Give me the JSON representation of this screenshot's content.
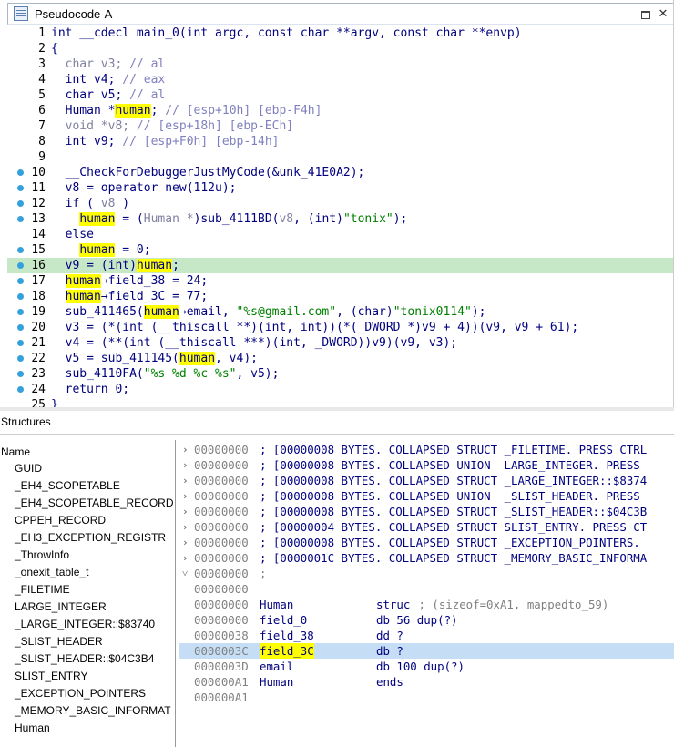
{
  "pseudocode": {
    "tab_title": "Pseudocode-A",
    "max_icon": "maximize-icon",
    "close_icon": "close-icon",
    "lines": [
      {
        "n": "1",
        "bp": false,
        "tokens": [
          {
            "t": "int __cdecl main_0(int argc, const char **argv, const char **envp)",
            "c": "kw"
          }
        ]
      },
      {
        "n": "2",
        "bp": false,
        "tokens": [
          {
            "t": "{",
            "c": "kw"
          }
        ]
      },
      {
        "n": "3",
        "bp": false,
        "tokens": [
          {
            "t": "  char v3; ",
            "c": "dim"
          },
          {
            "t": "// al",
            "c": "cm"
          }
        ]
      },
      {
        "n": "4",
        "bp": false,
        "tokens": [
          {
            "t": "  int v4; ",
            "c": "kw"
          },
          {
            "t": "// eax",
            "c": "cm"
          }
        ]
      },
      {
        "n": "5",
        "bp": false,
        "tokens": [
          {
            "t": "  char v5; ",
            "c": "kw"
          },
          {
            "t": "// al",
            "c": "cm"
          }
        ]
      },
      {
        "n": "6",
        "bp": false,
        "tokens": [
          {
            "t": "  Human *",
            "c": "kw"
          },
          {
            "t": "human",
            "c": "hlw"
          },
          {
            "t": "; ",
            "c": "kw"
          },
          {
            "t": "// [esp+10h] [ebp-F4h]",
            "c": "cm"
          }
        ]
      },
      {
        "n": "7",
        "bp": false,
        "tokens": [
          {
            "t": "  void *v8; ",
            "c": "dim"
          },
          {
            "t": "// [esp+18h] [ebp-ECh]",
            "c": "cm"
          }
        ]
      },
      {
        "n": "8",
        "bp": false,
        "tokens": [
          {
            "t": "  int v9; ",
            "c": "kw"
          },
          {
            "t": "// [esp+F0h] [ebp-14h]",
            "c": "cm"
          }
        ]
      },
      {
        "n": "9",
        "bp": false,
        "tokens": [
          {
            "t": "",
            "c": "kw"
          }
        ]
      },
      {
        "n": "10",
        "bp": true,
        "tokens": [
          {
            "t": "  __CheckForDebuggerJustMyCode(&unk_41E0A2);",
            "c": "kw"
          }
        ]
      },
      {
        "n": "11",
        "bp": true,
        "tokens": [
          {
            "t": "  v8 = operator new(112u);",
            "c": "kw"
          }
        ]
      },
      {
        "n": "12",
        "bp": true,
        "tokens": [
          {
            "t": "  if ( ",
            "c": "kw"
          },
          {
            "t": "v8",
            "c": "dim"
          },
          {
            "t": " )",
            "c": "kw"
          }
        ]
      },
      {
        "n": "13",
        "bp": true,
        "tokens": [
          {
            "t": "    ",
            "c": "kw"
          },
          {
            "t": "human",
            "c": "hlw"
          },
          {
            "t": " = (",
            "c": "kw"
          },
          {
            "t": "Human *",
            "c": "dim"
          },
          {
            "t": ")sub_4111BD(",
            "c": "kw"
          },
          {
            "t": "v8",
            "c": "dim"
          },
          {
            "t": ", (int)",
            "c": "kw"
          },
          {
            "t": "\"tonix\"",
            "c": "str"
          },
          {
            "t": ");",
            "c": "kw"
          }
        ]
      },
      {
        "n": "14",
        "bp": false,
        "tokens": [
          {
            "t": "  else",
            "c": "kw"
          }
        ]
      },
      {
        "n": "15",
        "bp": true,
        "tokens": [
          {
            "t": "    ",
            "c": "kw"
          },
          {
            "t": "human",
            "c": "hlw"
          },
          {
            "t": " = 0;",
            "c": "kw"
          }
        ]
      },
      {
        "n": "16",
        "bp": true,
        "hl": true,
        "tokens": [
          {
            "t": "  v9 = ",
            "c": "kw"
          },
          {
            "t": "(int)",
            "c": "kw"
          },
          {
            "t": "human",
            "c": "hlw"
          },
          {
            "t": ";",
            "c": "kw"
          }
        ]
      },
      {
        "n": "17",
        "bp": true,
        "tokens": [
          {
            "t": "  ",
            "c": "kw"
          },
          {
            "t": "human",
            "c": "hlw"
          },
          {
            "t": "→field_38 = 24;",
            "c": "kw"
          }
        ]
      },
      {
        "n": "18",
        "bp": true,
        "tokens": [
          {
            "t": "  ",
            "c": "kw"
          },
          {
            "t": "human",
            "c": "hlw"
          },
          {
            "t": "→field_3C = 77;",
            "c": "kw"
          }
        ]
      },
      {
        "n": "19",
        "bp": true,
        "tokens": [
          {
            "t": "  sub_411465(",
            "c": "kw"
          },
          {
            "t": "human",
            "c": "hlw"
          },
          {
            "t": "→email, ",
            "c": "kw"
          },
          {
            "t": "\"%s@gmail.com\"",
            "c": "str"
          },
          {
            "t": ", (char)",
            "c": "kw"
          },
          {
            "t": "\"tonix0114\"",
            "c": "str"
          },
          {
            "t": ");",
            "c": "kw"
          }
        ]
      },
      {
        "n": "20",
        "bp": true,
        "tokens": [
          {
            "t": "  v3 = (*(int (__thiscall **)(int, int))(*(_DWORD *)v9 + 4))(v9, v9 + 61);",
            "c": "kw"
          }
        ]
      },
      {
        "n": "21",
        "bp": true,
        "tokens": [
          {
            "t": "  v4 = (**(int (__thiscall ***)(int, _DWORD))v9)(v9, v3);",
            "c": "kw"
          }
        ]
      },
      {
        "n": "22",
        "bp": true,
        "tokens": [
          {
            "t": "  v5 = sub_411145(",
            "c": "kw"
          },
          {
            "t": "human",
            "c": "hlw"
          },
          {
            "t": ", v4);",
            "c": "kw"
          }
        ]
      },
      {
        "n": "23",
        "bp": true,
        "tokens": [
          {
            "t": "  sub_4110FA(",
            "c": "kw"
          },
          {
            "t": "\"%s %d %c %s\"",
            "c": "str"
          },
          {
            "t": ", v5);",
            "c": "kw"
          }
        ]
      },
      {
        "n": "24",
        "bp": true,
        "tokens": [
          {
            "t": "  return 0;",
            "c": "kw"
          }
        ]
      },
      {
        "n": "25",
        "bp": false,
        "tokens": [
          {
            "t": "}",
            "c": "kw"
          }
        ]
      }
    ]
  },
  "structures": {
    "title": "Structures",
    "list_header": "Name",
    "items": [
      "GUID",
      "_EH4_SCOPETABLE",
      "_EH4_SCOPETABLE_RECORD",
      "CPPEH_RECORD",
      "_EH3_EXCEPTION_REGISTR",
      "_ThrowInfo",
      "_onexit_table_t",
      "_FILETIME",
      "LARGE_INTEGER",
      "_LARGE_INTEGER::$83740",
      "_SLIST_HEADER",
      "_SLIST_HEADER::$04C3B4",
      "SLIST_ENTRY",
      "_EXCEPTION_POINTERS",
      "_MEMORY_BASIC_INFORMAT",
      "Human"
    ],
    "collapsed": [
      {
        "addr": "00000000",
        "text": "; [00000008 BYTES. COLLAPSED STRUCT _FILETIME. PRESS CTRL"
      },
      {
        "addr": "00000000",
        "text": "; [00000008 BYTES. COLLAPSED UNION  LARGE_INTEGER. PRESS "
      },
      {
        "addr": "00000000",
        "text": "; [00000008 BYTES. COLLAPSED STRUCT _LARGE_INTEGER::$8374"
      },
      {
        "addr": "00000000",
        "text": "; [00000008 BYTES. COLLAPSED UNION  _SLIST_HEADER. PRESS "
      },
      {
        "addr": "00000000",
        "text": "; [00000008 BYTES. COLLAPSED STRUCT _SLIST_HEADER::$04C3B"
      },
      {
        "addr": "00000000",
        "text": "; [00000004 BYTES. COLLAPSED STRUCT SLIST_ENTRY. PRESS CT"
      },
      {
        "addr": "00000000",
        "text": "; [00000008 BYTES. COLLAPSED STRUCT _EXCEPTION_POINTERS."
      },
      {
        "addr": "00000000",
        "text": "; [0000001C BYTES. COLLAPSED STRUCT _MEMORY_BASIC_INFORMA"
      }
    ],
    "expanded_addr": "00000000",
    "expanded_marker": ";",
    "blank_addr": "00000000",
    "fields": [
      {
        "addr": "00000000",
        "name": "Human",
        "type": "struc",
        "extra": "; (sizeof=0xA1, mappedto_59)"
      },
      {
        "addr": "00000000",
        "name": "field_0",
        "type": "db 56 dup(?)",
        "extra": ""
      },
      {
        "addr": "00000038",
        "name": "field_38",
        "type": "dd ?",
        "extra": ""
      },
      {
        "addr": "0000003C",
        "name": "field_3C",
        "type": "db ?",
        "extra": "",
        "selected": true
      },
      {
        "addr": "0000003D",
        "name": "email",
        "type": "db 100 dup(?)",
        "extra": ""
      },
      {
        "addr": "000000A1",
        "name": "Human",
        "type": "ends",
        "extra": ""
      }
    ],
    "tail_addr": "000000A1"
  }
}
